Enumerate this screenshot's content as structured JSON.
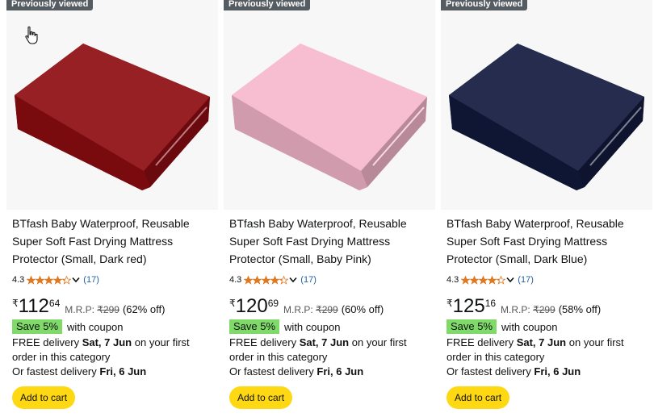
{
  "products": [
    {
      "badge": "Previously viewed",
      "title": "BTfash Baby Waterproof, Reusable Super Soft Fast Drying Mattress Protector (Small, Dark red)",
      "rating": "4.3",
      "rating_value": 4.3,
      "review_count": "(17)",
      "currency": "₹",
      "price_whole": "112",
      "price_fraction": "64",
      "mrp_label": "M.R.P:",
      "mrp_value": "₹299",
      "discount": "(62% off)",
      "coupon_badge": "Save 5%",
      "coupon_text": "with coupon",
      "delivery_prefix": "FREE delivery",
      "delivery_date": "Sat, 7 Jun",
      "delivery_suffix": "on your first order in this category",
      "fastest_prefix": "Or fastest delivery",
      "fastest_date": "Fri, 6 Jun",
      "add_to_cart": "Add to cart",
      "color": "#8e0d12"
    },
    {
      "badge": "Previously viewed",
      "title": "BTfash Baby Waterproof, Reusable Super Soft Fast Drying Mattress Protector (Small, Baby Pink)",
      "rating": "4.3",
      "rating_value": 4.3,
      "review_count": "(17)",
      "currency": "₹",
      "price_whole": "120",
      "price_fraction": "69",
      "mrp_label": "M.R.P:",
      "mrp_value": "₹299",
      "discount": "(60% off)",
      "coupon_badge": "Save 5%",
      "coupon_text": "with coupon",
      "delivery_prefix": "FREE delivery",
      "delivery_date": "Sat, 7 Jun",
      "delivery_suffix": "on your first order in this category",
      "fastest_prefix": "Or fastest delivery",
      "fastest_date": "Fri, 6 Jun",
      "add_to_cart": "Add to cart",
      "color": "#f5b8cc"
    },
    {
      "badge": "Previously viewed",
      "title": "BTfash Baby Waterproof, Reusable Super Soft Fast Drying Mattress Protector (Small, Dark Blue)",
      "rating": "4.3",
      "rating_value": 4.3,
      "review_count": "(17)",
      "currency": "₹",
      "price_whole": "125",
      "price_fraction": "16",
      "mrp_label": "M.R.P:",
      "mrp_value": "₹299",
      "discount": "(58% off)",
      "coupon_badge": "Save 5%",
      "coupon_text": "with coupon",
      "delivery_prefix": "FREE delivery",
      "delivery_date": "Sat, 7 Jun",
      "delivery_suffix": "on your first order in this category",
      "fastest_prefix": "Or fastest delivery",
      "fastest_date": "Fri, 6 Jun",
      "add_to_cart": "Add to cart",
      "color": "#121a3d"
    }
  ],
  "colors": {
    "star": "#de7921",
    "link": "#2162a1",
    "coupon_bg": "#7fda69",
    "cart_button": "#ffd814",
    "badge_bg": "#555c62"
  },
  "icons": [
    "star-icon",
    "chevron-down-icon",
    "hand-cursor-icon"
  ]
}
